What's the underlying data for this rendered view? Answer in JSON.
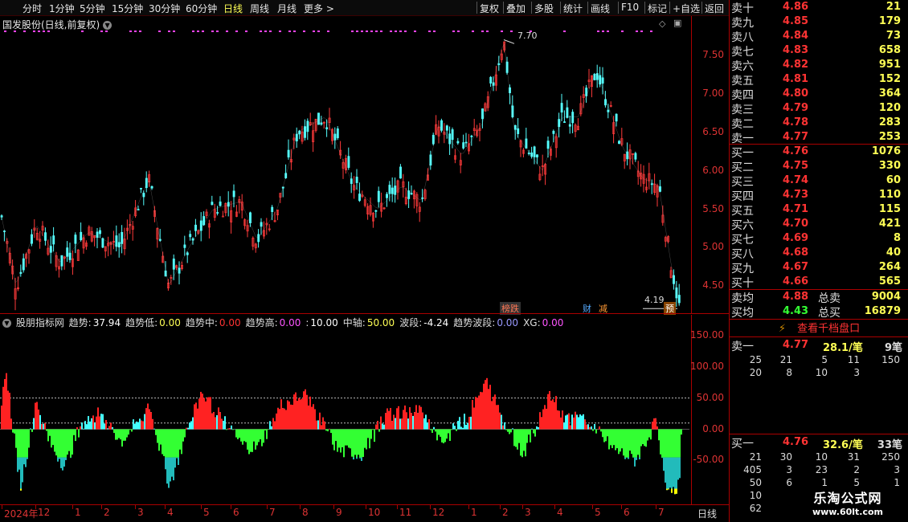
{
  "toolbar": {
    "periods": [
      "分时",
      "1分钟",
      "5分钟",
      "15分钟",
      "30分钟",
      "60分钟",
      "日线",
      "周线",
      "月线",
      "更多 >"
    ],
    "active": "日线",
    "actions": [
      "复权",
      "叠加",
      "多股",
      "统计",
      "画线",
      "F10",
      "标记",
      "+自选",
      "返回"
    ]
  },
  "chart": {
    "title": "国发股份(日线,前复权)",
    "high_label": "7.70",
    "low_label": "4.19",
    "y_ticks": [
      "7.50",
      "7.00",
      "6.50",
      "6.00",
      "5.50",
      "5.00",
      "4.50"
    ],
    "y_range": [
      4.15,
      7.82
    ],
    "annotations": [
      "榜跌",
      "财",
      "减",
      "预"
    ],
    "colors": {
      "up": "#ff3a3a",
      "down": "#54ffff",
      "ma": "#dddddd"
    }
  },
  "indicator": {
    "name": "股朋指标网",
    "items": [
      {
        "label": "趋势:",
        "value": "37.94",
        "color": "#ffffff"
      },
      {
        "label": "趋势低:",
        "value": "0.00",
        "color": "#ffff55"
      },
      {
        "label": "趋势中:",
        "value": "0.00",
        "color": "#ff3333"
      },
      {
        "label": "趋势高:",
        "value": "0.00",
        "color": "#ff55ff"
      },
      {
        "label": ":",
        "value": "10.00",
        "color": "#ffffff"
      },
      {
        "label": "中轴:",
        "value": "50.00",
        "color": "#ffff55"
      },
      {
        "label": "波段:",
        "value": "-4.24",
        "color": "#ffffff"
      },
      {
        "label": "趋势波段:",
        "value": "0.00",
        "color": "#9999ff"
      },
      {
        "label": "XG:",
        "value": "0.00",
        "color": "#ff55ff"
      }
    ],
    "y_ticks": [
      "150.00",
      "100.00",
      "50.00",
      "0.00",
      "-50.00"
    ],
    "y_range": [
      -120,
      165
    ]
  },
  "xaxis": {
    "ticks": [
      "2024年",
      "12",
      "1",
      "2",
      "3",
      "4",
      "5",
      "6",
      "7",
      "8",
      "9",
      "10",
      "11",
      "12",
      "1",
      "2",
      "3",
      "4",
      "5",
      "6",
      "7"
    ],
    "period_label": "日线"
  },
  "orderbook": {
    "asks": [
      {
        "label": "卖十",
        "price": "4.86",
        "qty": "21"
      },
      {
        "label": "卖九",
        "price": "4.85",
        "qty": "179"
      },
      {
        "label": "卖八",
        "price": "4.84",
        "qty": "73"
      },
      {
        "label": "卖七",
        "price": "4.83",
        "qty": "658"
      },
      {
        "label": "卖六",
        "price": "4.82",
        "qty": "951"
      },
      {
        "label": "卖五",
        "price": "4.81",
        "qty": "152"
      },
      {
        "label": "卖四",
        "price": "4.80",
        "qty": "364"
      },
      {
        "label": "卖三",
        "price": "4.79",
        "qty": "120"
      },
      {
        "label": "卖二",
        "price": "4.78",
        "qty": "283"
      },
      {
        "label": "卖一",
        "price": "4.77",
        "qty": "253"
      }
    ],
    "bids": [
      {
        "label": "买一",
        "price": "4.76",
        "qty": "1076"
      },
      {
        "label": "买二",
        "price": "4.75",
        "qty": "330"
      },
      {
        "label": "买三",
        "price": "4.74",
        "qty": "60"
      },
      {
        "label": "买四",
        "price": "4.73",
        "qty": "110"
      },
      {
        "label": "买五",
        "price": "4.71",
        "qty": "115"
      },
      {
        "label": "买六",
        "price": "4.70",
        "qty": "421"
      },
      {
        "label": "买七",
        "price": "4.69",
        "qty": "8"
      },
      {
        "label": "买八",
        "price": "4.68",
        "qty": "40"
      },
      {
        "label": "买九",
        "price": "4.67",
        "qty": "264"
      },
      {
        "label": "买十",
        "price": "4.66",
        "qty": "565"
      }
    ],
    "avg_sell": {
      "label": "卖均",
      "price": "4.88",
      "total_label": "总卖",
      "total": "9004"
    },
    "avg_buy": {
      "label": "买均",
      "price": "4.43",
      "total_label": "总买",
      "total": "16879"
    },
    "view_button": "查看千档盘口",
    "sell1": {
      "label": "卖一",
      "price": "4.77",
      "avg": "28.1/笔",
      "count": "9笔"
    },
    "sell1_orders": [
      [
        "25",
        "21",
        "5",
        "11",
        "150"
      ],
      [
        "20",
        "8",
        "10",
        "3",
        ""
      ]
    ],
    "buy1": {
      "label": "买一",
      "price": "4.76",
      "avg": "32.6/笔",
      "count": "33笔"
    },
    "buy1_orders": [
      [
        "21",
        "30",
        "10",
        "31",
        "250"
      ],
      [
        "405",
        "3",
        "23",
        "2",
        "3"
      ],
      [
        "50",
        "6",
        "1",
        "5",
        "1"
      ],
      [
        "10",
        "",
        "",
        "",
        ""
      ],
      [
        "62",
        "",
        "",
        "",
        ""
      ]
    ]
  },
  "watermark": {
    "line1": "乐淘公式网",
    "line2": "www.60lt.com"
  }
}
